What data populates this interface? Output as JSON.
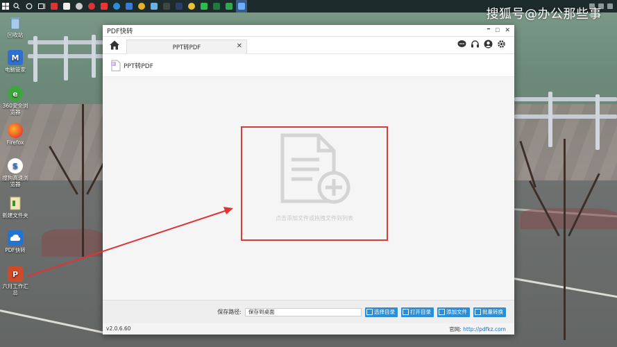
{
  "watermark": "搜狐号@办公那些事",
  "desktop_icons": [
    {
      "label": "回收站",
      "icon": "recycle-bin-icon",
      "color": "#6aa8d8"
    },
    {
      "label": "电脑管家",
      "icon": "pc-manager-icon",
      "color": "#2e6fd0"
    },
    {
      "label": "360安全浏览器",
      "icon": "browser-360-icon",
      "color": "#3aa83a"
    },
    {
      "label": "Firefox",
      "icon": "firefox-icon",
      "color": "#e8652a"
    },
    {
      "label": "搜狗高速浏览器",
      "icon": "sogou-browser-icon",
      "color": "#2c7fd0"
    },
    {
      "label": "新建文件夹",
      "icon": "folder-icon",
      "color": "#e6c15a"
    },
    {
      "label": "PDF快转",
      "icon": "pdf-convert-icon",
      "color": "#1f74d6"
    },
    {
      "label": "六月工作汇总",
      "icon": "ppt-file-icon",
      "color": "#d04a2a"
    }
  ],
  "window": {
    "title": "PDF快转",
    "controls": {
      "minimize": "━",
      "maximize": "□",
      "close": "✕"
    },
    "tab": {
      "label": "PPT转PDF",
      "close": "✕"
    },
    "section_title": "PPT转PDF",
    "drop_hint": "点击添加文件或拖拽文件到列表",
    "save_path_label": "保存路径:",
    "save_path_value": "保存到桌面",
    "buttons": {
      "choose_dir": "选择目录",
      "open_dir": "打开目录",
      "add_file": "添加文件",
      "batch_convert": "批量转换"
    },
    "version": "v2.0.6.60",
    "website_label": "官网:",
    "website_url": "http://pdfkz.com"
  },
  "colors": {
    "accent": "#2a8fd8",
    "highlight": "#d93a3a",
    "arrow": "#e03434"
  }
}
